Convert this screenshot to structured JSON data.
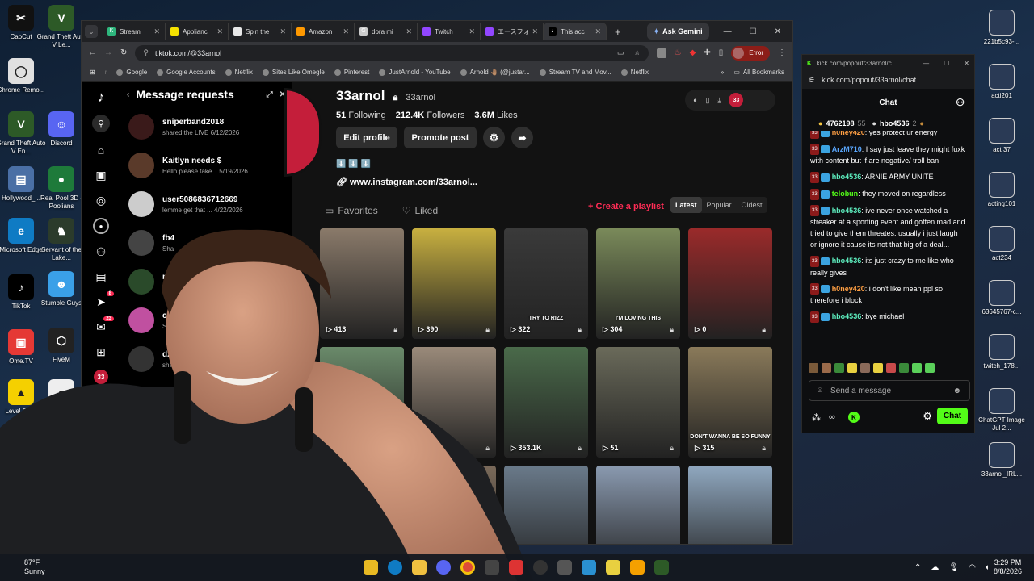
{
  "desktop": {
    "left_icons": [
      {
        "label": "CapCut",
        "color": "#111111",
        "glyph": "✂"
      },
      {
        "label": "Grand Theft Auto V Le...",
        "color": "#2d5a27",
        "glyph": "V"
      },
      {
        "label": "Chrome Remo...",
        "color": "#e0e0e0",
        "glyph": "◯"
      },
      {
        "label": "Discord",
        "color": "#5865f2",
        "glyph": "☺"
      },
      {
        "label": "Grand Theft Auto V En...",
        "color": "#2d5a27",
        "glyph": "V"
      },
      {
        "label": "Hollywood_...",
        "color": "#4a6fa5",
        "glyph": "▤"
      },
      {
        "label": "Real Pool 3D - Poolians",
        "color": "#1e7a3a",
        "glyph": "●"
      },
      {
        "label": "Microsoft Edge",
        "color": "#0f7bc4",
        "glyph": "e"
      },
      {
        "label": "Servant of the Lake...",
        "color": "#2b3b2b",
        "glyph": "♞"
      },
      {
        "label": "TikTok",
        "color": "#000000",
        "glyph": "♪"
      },
      {
        "label": "Stumble Guys",
        "color": "#3aa0e8",
        "glyph": "☻"
      },
      {
        "label": "Ome.TV",
        "color": "#e53935",
        "glyph": "▣"
      },
      {
        "label": "FiveM",
        "color": "#222222",
        "glyph": "⬡"
      },
      {
        "label": "Level Devil",
        "color": "#f5d000",
        "glyph": "▲"
      },
      {
        "label": "Marbles on Stream",
        "color": "#eeeeee",
        "glyph": "●"
      },
      {
        "label": "Roblox Player",
        "color": "#2f6fe4",
        "glyph": "■"
      }
    ],
    "right_icons": [
      {
        "label": "221b5c93-..."
      },
      {
        "label": "acti201"
      },
      {
        "label": "act 37"
      },
      {
        "label": "acting101"
      },
      {
        "label": "act234"
      },
      {
        "label": "63645767-c..."
      },
      {
        "label": "twitch_178..."
      },
      {
        "label": "ChatGPT Image Jul 2..."
      },
      {
        "label": "33arnol_IRL..."
      }
    ]
  },
  "browser": {
    "tabs": [
      {
        "title": "Stream",
        "color": "#2eb67d",
        "glyph": "K"
      },
      {
        "title": "Applianc",
        "color": "#f5e100",
        "glyph": ""
      },
      {
        "title": "Spin the",
        "color": "#e8e8e8",
        "glyph": ""
      },
      {
        "title": "Amazon",
        "color": "#ff9900",
        "glyph": ""
      },
      {
        "title": "dora mi",
        "color": "#cccccc",
        "glyph": "G"
      },
      {
        "title": "Twitch",
        "color": "#9146ff",
        "glyph": ""
      },
      {
        "title": "エースフォ",
        "color": "#9146ff",
        "glyph": ""
      },
      {
        "title": "This acc",
        "color": "#000000",
        "glyph": "♪"
      }
    ],
    "ask_gemini": "Ask Gemini",
    "url": "tiktok.com/@33arnol",
    "error_label": "Error",
    "bookmarks": [
      "Google",
      "Google Accounts",
      "Netflix",
      "Sites Like Omegle",
      "Pinterest",
      "JustArnold - YouTube",
      "Arnold 🤚🏽 (@justar...",
      "Stream TV and Mov...",
      "Netflix"
    ],
    "all_bookmarks": "All Bookmarks"
  },
  "messages": {
    "title": "Message requests",
    "items": [
      {
        "name": "sniperband2018",
        "preview": "shared the LIVE",
        "date": "6/12/2026",
        "color": "#3a1a1a"
      },
      {
        "name": "Kaitlyn needs $",
        "preview": "Hello please take...",
        "date": "5/19/2026",
        "color": "#5a3a2a"
      },
      {
        "name": "user5086836712669",
        "preview": "lemme get that ...",
        "date": "4/22/2026",
        "color": "#cccccc"
      },
      {
        "name": "fb4",
        "preview": "Sha",
        "date": "",
        "color": "#444444"
      },
      {
        "name": "ma",
        "preview": "T",
        "date": "",
        "color": "#2a4a2a"
      },
      {
        "name": "cute",
        "preview": "Share",
        "date": "",
        "color": "#c050a0"
      },
      {
        "name": "dzjordzis",
        "preview": "shared",
        "date": "",
        "color": "#333333"
      }
    ]
  },
  "profile": {
    "display_name": "33arnol",
    "handle": "33arnol",
    "following": "51",
    "following_label": "Following",
    "followers": "212.4K",
    "followers_label": "Followers",
    "likes": "3.6M",
    "likes_label": "Likes",
    "edit_profile": "Edit profile",
    "promote_post": "Promote post",
    "bio": "⬇️ ⬇️ ⬇️",
    "link": "www.instagram.com/33arnol...",
    "tab_favorites": "Favorites",
    "tab_liked": "Liked",
    "create_playlist": "+ Create a playlist",
    "sort_latest": "Latest",
    "sort_popular": "Popular",
    "sort_oldest": "Oldest",
    "avatar_badge": "33",
    "videos": [
      {
        "count": "413",
        "caption": "",
        "color": "#8a7a6a"
      },
      {
        "count": "390",
        "caption": "",
        "color": "#c8b040"
      },
      {
        "count": "322",
        "caption": "TRY TO RIZZ",
        "color": "#3a3a3a"
      },
      {
        "count": "304",
        "caption": "I'M LOVING THIS",
        "color": "#7a8a5a"
      },
      {
        "count": "0",
        "caption": "",
        "color": "#9a2a2a"
      },
      {
        "count": "",
        "caption": "",
        "color": "#6a8a6a"
      },
      {
        "count": "",
        "caption": "",
        "color": "#9a8a7a"
      },
      {
        "count": "353.1K",
        "caption": "",
        "color": "#4a6a4a"
      },
      {
        "count": "51",
        "caption": "",
        "color": "#6a6a5a"
      },
      {
        "count": "315",
        "caption": "DON'T WANNA BE SO FUNNY",
        "color": "#8a7a5a"
      },
      {
        "count": "",
        "caption": "",
        "color": "#7a8aa0"
      },
      {
        "count": "",
        "caption": "",
        "color": "#7a6a5a"
      },
      {
        "count": "",
        "caption": "",
        "color": "#6a7a8a"
      },
      {
        "count": "",
        "caption": "",
        "color": "#8a9ab0"
      },
      {
        "count": "",
        "caption": "",
        "color": "#90a8c0"
      }
    ]
  },
  "kick": {
    "window_title": "kick.com/popout/33arnol/c...",
    "url": "kick.com/popout/33arnol/chat",
    "header": "Chat",
    "gifter1_amount": "4762198",
    "gifter1_extra": "55",
    "gifter2_name": "hbo4536",
    "gifter2_extra": "2",
    "messages": [
      {
        "user": "h0ney420",
        "text": ": yes protect ur energy",
        "color": "#ff9f43",
        "partial": true
      },
      {
        "user": "ArzM710",
        "text": ": I say just leave they might fuxk with content but if are negative/ troll ban",
        "color": "#5aa8ff"
      },
      {
        "user": "hbo4536",
        "text": ": ARNIE ARMY UNITE",
        "color": "#5ef0c0"
      },
      {
        "user": "telobun",
        "text": ": they moved on regardless",
        "color": "#53fc18"
      },
      {
        "user": "hbo4536",
        "text": ": ive never once watched a streaker at a sporting event and gotten mad and tried to give them threates. usually i just laugh or ignore it cause its not that big of a deal...",
        "color": "#5ef0c0"
      },
      {
        "user": "hbo4536",
        "text": ": its just crazy to me like who really gives",
        "color": "#5ef0c0"
      },
      {
        "user": "h0ney420",
        "text": ": i don't like mean ppl so therefore i block",
        "color": "#ff9f43"
      },
      {
        "user": "hbo4536",
        "text": ": bye michael",
        "color": "#5ef0c0"
      }
    ],
    "sub_tag": "33",
    "send_placeholder": "Send a message",
    "chat_button": "Chat"
  },
  "taskbar": {
    "weather_temp": "87°F",
    "weather_text": "Sunny",
    "time": "3:29 PM",
    "date": "8/8/2026"
  }
}
